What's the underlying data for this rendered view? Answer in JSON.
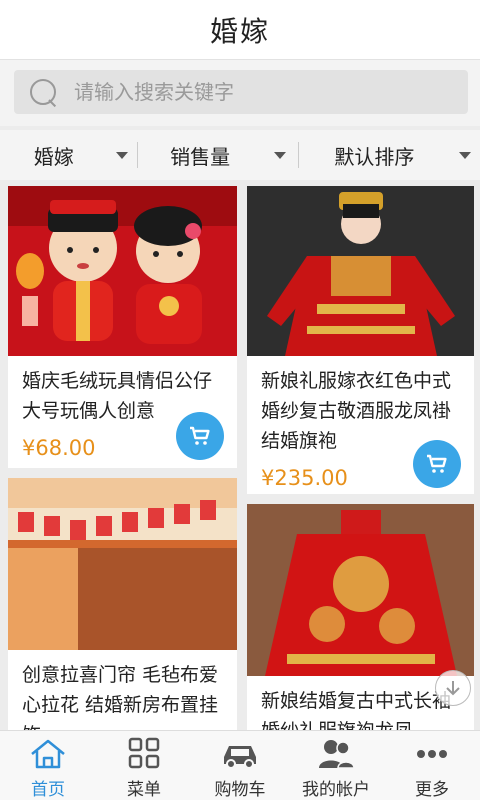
{
  "header": {
    "title": "婚嫁"
  },
  "search": {
    "placeholder": "请输入搜索关键字"
  },
  "filters": [
    {
      "label": "婚嫁"
    },
    {
      "label": "销售量"
    },
    {
      "label": "默认排序"
    }
  ],
  "products": [
    {
      "title": "婚庆毛绒玩具情侣公仔大号玩偶人创意",
      "price": "¥68.00"
    },
    {
      "title": "新娘礼服嫁衣红色中式婚纱复古敬酒服龙凤褂结婚旗袍",
      "price": "¥235.00"
    },
    {
      "title": "创意拉喜门帘 毛毡布爱心拉花 结婚新房布置挂饰",
      "price": ""
    },
    {
      "title": "新娘结婚复古中式长袖婚纱礼服旗袍龙凤",
      "price": ""
    }
  ],
  "tabs": [
    {
      "label": "首页",
      "icon": "home-icon"
    },
    {
      "label": "菜单",
      "icon": "grid-menu-icon"
    },
    {
      "label": "购物车",
      "icon": "car-icon"
    },
    {
      "label": "我的帐户",
      "icon": "users-icon"
    },
    {
      "label": "更多",
      "icon": "more-dots-icon"
    }
  ],
  "colors": {
    "accent": "#3aa6e7",
    "price": "#e7901a",
    "active_tab": "#2f8fd8"
  }
}
